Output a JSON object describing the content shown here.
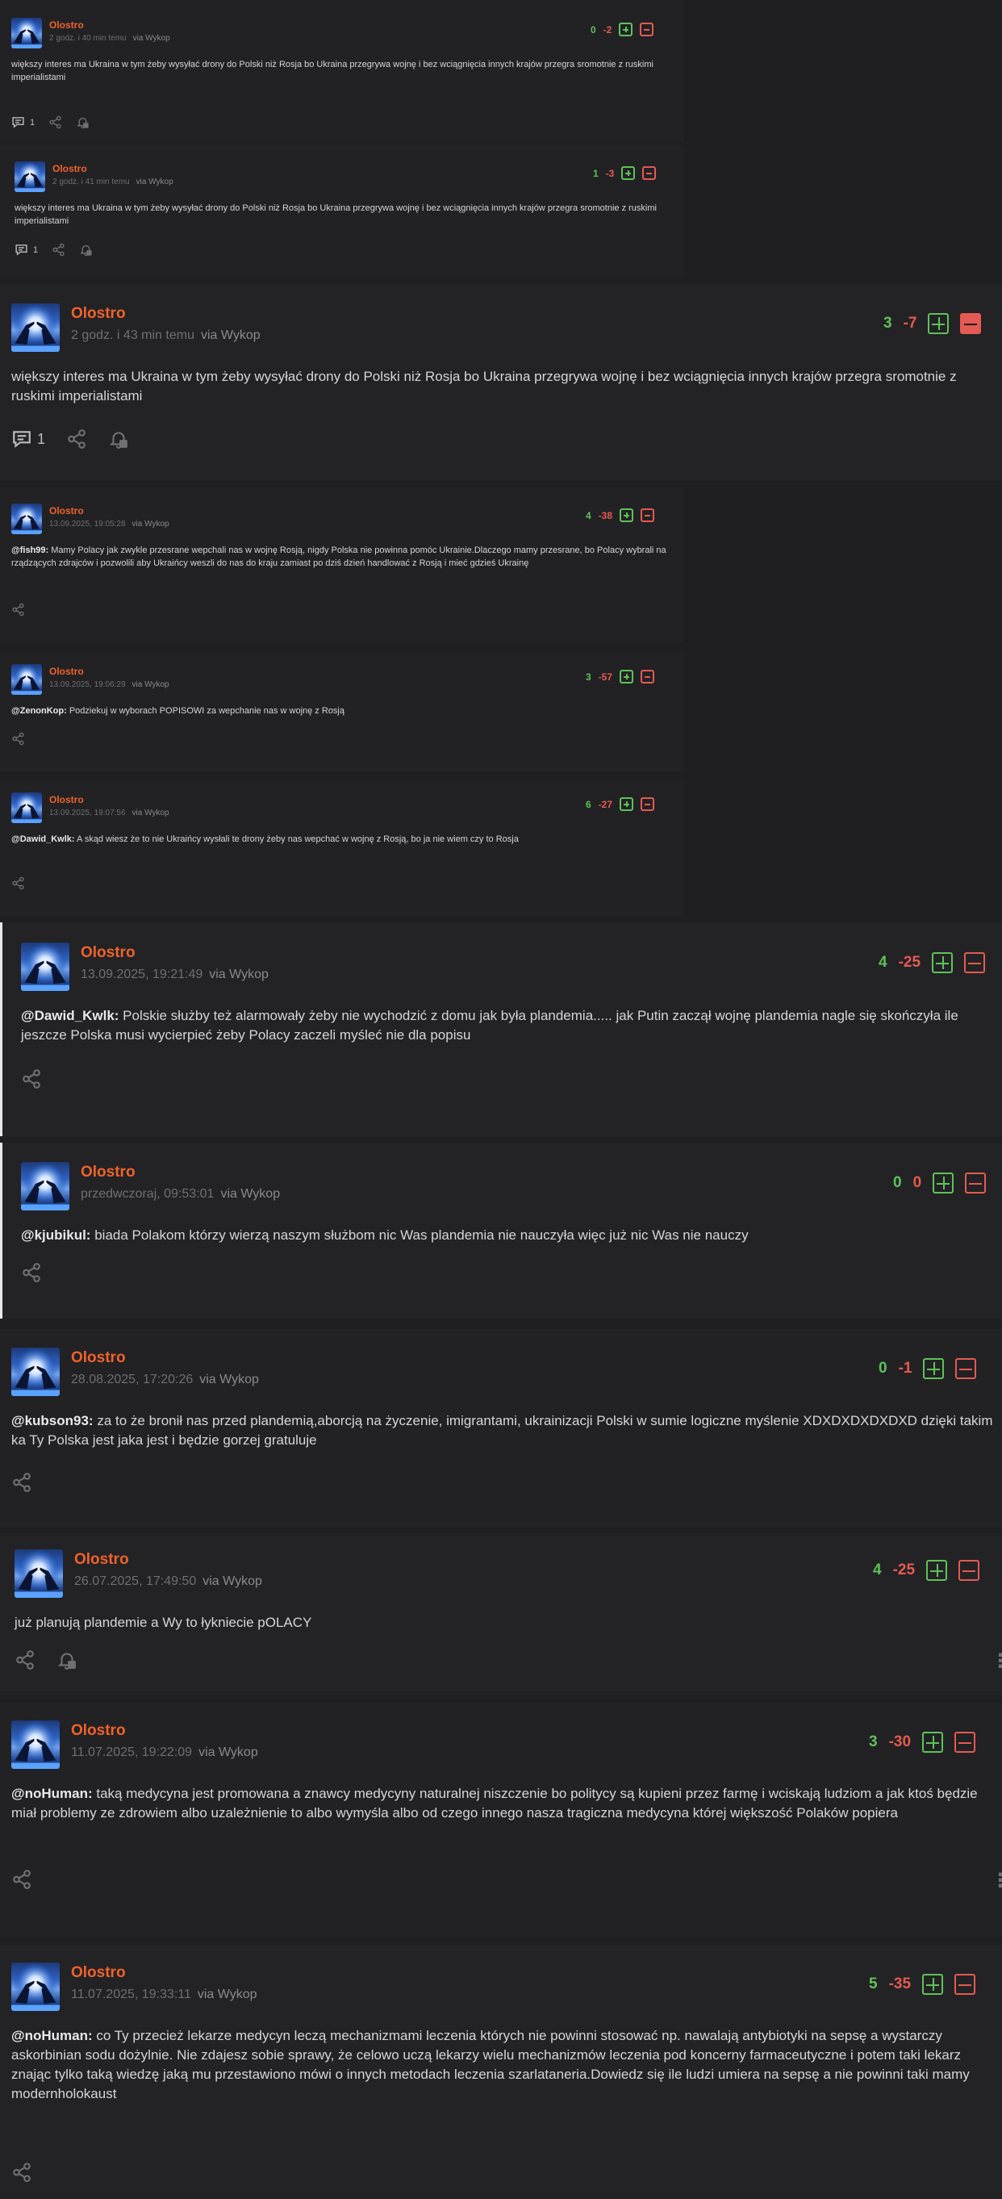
{
  "via": "via Wykop",
  "comments": [
    {
      "author": "Olostro",
      "time": "2 godz. i 40 min temu",
      "plus": "0",
      "minus": "-2",
      "text": "większy interes ma Ukraina w tym żeby wysyłać drony do Polski niż Rosja bo Ukraina przegrywa wojnę i bez wciągnięcia innych krajów przegra sromotnie z ruskimi imperialistami",
      "replies": "1"
    },
    {
      "author": "Olostro",
      "time": "2 godz. i 41 min temu",
      "plus": "1",
      "minus": "-3",
      "text": "większy interes ma Ukraina w tym żeby wysyłać drony do Polski niż Rosja bo Ukraina przegrywa wojnę i bez wciągnięcia innych krajów przegra sromotnie z ruskimi imperialistami",
      "replies": "1"
    },
    {
      "author": "Olostro",
      "time": "2 godz. i 43 min temu",
      "plus": "3",
      "minus": "-7",
      "text": "większy interes ma Ukraina w tym żeby wysyłać drony do Polski niż Rosja bo Ukraina przegrywa wojnę i bez wciągnięcia innych krajów przegra sromotnie z ruskimi imperialistami",
      "replies": "1"
    },
    {
      "author": "Olostro",
      "time": "13.09.2025, 19:05:28",
      "plus": "4",
      "minus": "-38",
      "mention": "@fish99:",
      "text": " Mamy Polacy jak zwykle przesrane wepchali nas w wojnę Rosją, nigdy Polska nie powinna pomóc Ukrainie.Dlaczego mamy przesrane, bo Polacy wybrali na rządzących zdrajców i pozwolili aby Ukraińcy weszli do nas do kraju zamiast po dziś dzień handlować z Rosją i mieć gdzieś Ukrainę"
    },
    {
      "author": "Olostro",
      "time": "13.09.2025, 19:06:29",
      "plus": "3",
      "minus": "-57",
      "mention": "@ZenonKop:",
      "text": " Podziekuj w wyborach POPISOWI za wepchanie nas w wojnę z Rosją"
    },
    {
      "author": "Olostro",
      "time": "13.09.2025, 19:07:56",
      "plus": "6",
      "minus": "-27",
      "mention": "@Dawid_Kwlk:",
      "text": " A skąd wiesz że to nie Ukraińcy wysłali te drony żeby nas wepchać w wojnę z Rosją, bo ja nie wiem czy to Rosja"
    },
    {
      "author": "Olostro",
      "time": "13.09.2025, 19:21:49",
      "plus": "4",
      "minus": "-25",
      "mention": "@Dawid_Kwlk:",
      "text": " Polskie służby też alarmowały żeby nie wychodzić z domu jak była plandemia..... jak Putin zaczął wojnę plandemia nagle się skończyła ile jeszcze Polska musi wycierpieć żeby Polacy zaczeli myśleć nie dla popisu"
    },
    {
      "author": "Olostro",
      "time": "przedwczoraj, 09:53:01",
      "plus": "0",
      "minus": "0",
      "mention": "@kjubikul:",
      "text": " biada Polakom którzy wierzą naszym służbom nic Was plandemia nie nauczyła więc już nic Was nie nauczy"
    },
    {
      "author": "Olostro",
      "time": "28.08.2025, 17:20:26",
      "plus": "0",
      "minus": "-1",
      "mention": "@kubson93:",
      "text": " za to że bronił nas przed plandemią,aborcją na życzenie, imigrantami, ukrainizacji Polski w sumie logiczne myślenie XDXDXDXDXDXD dzięki takim ka Ty Polska jest jaka jest i będzie gorzej gratuluje"
    },
    {
      "author": "Olostro",
      "time": "26.07.2025, 17:49:50",
      "plus": "4",
      "minus": "-25",
      "text": "już planują plandemie a Wy to łykniecie pOLACY"
    },
    {
      "author": "Olostro",
      "time": "11.07.2025, 19:22:09",
      "plus": "3",
      "minus": "-30",
      "mention": "@noHuman:",
      "text": " taką medycyna jest promowana a znawcy medycyny naturalnej niszczenie bo politycy są kupieni przez farmę i wciskają ludziom a jak ktoś będzie miał problemy ze zdrowiem albo uzależnienie to albo wymyśla albo od czego innego nasza tragiczna medycyna której większość Polaków popiera"
    },
    {
      "author": "Olostro",
      "time": "11.07.2025, 19:33:11",
      "plus": "5",
      "minus": "-35",
      "mention": "@noHuman:",
      "text": " co Ty przecież lekarze medycyn leczą mechanizmami leczenia których nie powinni stosować np. nawalają antybiotyki na sepsę a wystarczy askorbinian sodu dożylnie. Nie zdajesz sobie sprawy, że celowo uczą lekarzy wielu mechanizmów leczenia pod koncerny farmaceutyczne i potem taki lekarz znając tylko taką wiedzę jaką mu przestawiono mówi o innych metodach leczenia szarlataneria.Dowiedz się ile ludzi umiera na sepsę a nie powinni taki mamy modernholokaust"
    }
  ]
}
